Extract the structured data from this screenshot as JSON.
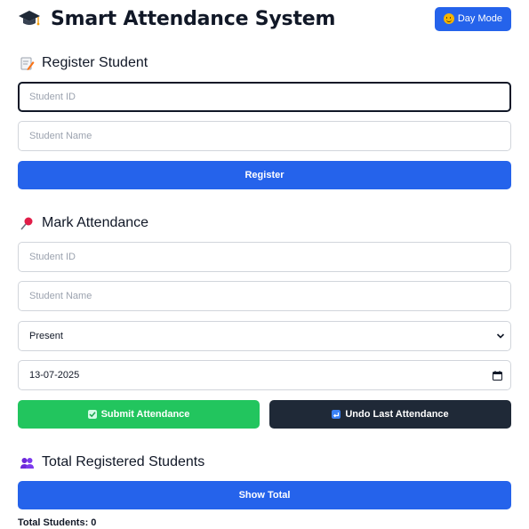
{
  "header": {
    "title": "Smart Attendance System",
    "mode_button": "Day Mode",
    "icon": "graduation-cap-icon"
  },
  "register": {
    "heading": "Register Student",
    "heading_icon": "memo-pencil-icon",
    "student_id_placeholder": "Student ID",
    "student_name_placeholder": "Student Name",
    "button": "Register"
  },
  "attendance": {
    "heading": "Mark Attendance",
    "heading_icon": "pushpin-icon",
    "student_id_placeholder": "Student ID",
    "student_name_placeholder": "Student Name",
    "status_selected": "Present",
    "date_value": "13-07-2025",
    "submit_button": "Submit Attendance",
    "undo_button": "Undo Last Attendance"
  },
  "total": {
    "heading": "Total Registered Students",
    "heading_icon": "people-icon",
    "button": "Show Total",
    "result": "Total Students: 0"
  },
  "colors": {
    "primary": "#2563eb",
    "success": "#22c55e",
    "dark": "#1f2937",
    "border": "#d1d5db"
  }
}
